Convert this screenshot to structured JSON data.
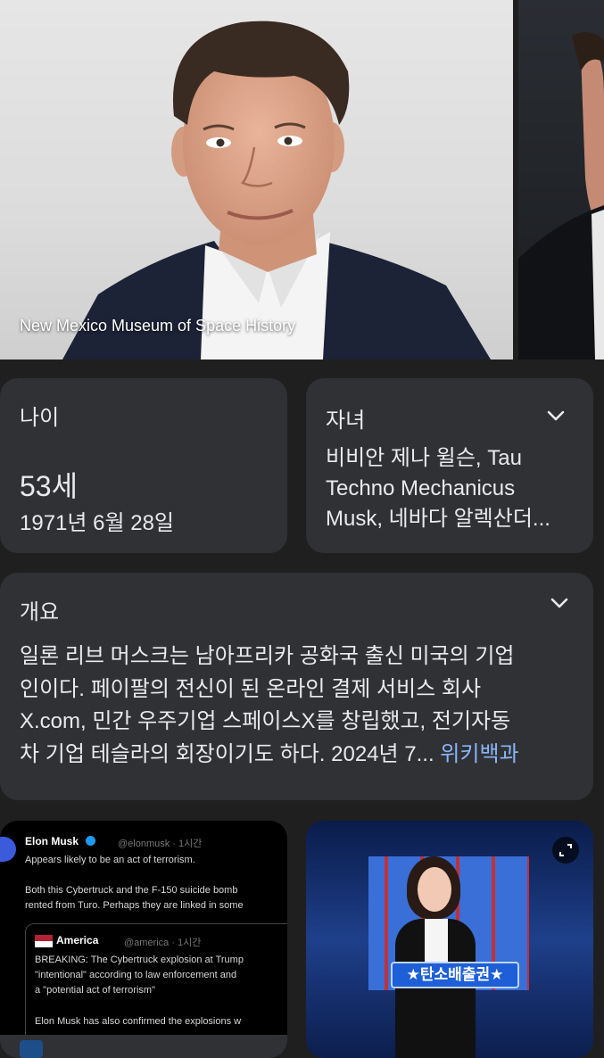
{
  "image_caption": "New Mexico Museum of Space History",
  "age_card": {
    "title": "나이",
    "value": "53세",
    "birthdate": "1971년 6월 28일"
  },
  "children_card": {
    "title": "자녀",
    "lines": [
      "비비안 제나 윌슨, Tau",
      "Techno Mechanicus",
      "Musk, 네바다 알렉산더..."
    ]
  },
  "overview_card": {
    "title": "개요",
    "lines": [
      "일론 리브 머스크는 남아프리카 공화국 출신 미국의 기업",
      "인이다. 페이팔의 전신이 된 온라인 결제 서비스 회사",
      "X.com, 민간 우주기업 스페이스X를 창립했고, 전기자동",
      "차 기업 테슬라의 회장이기도 하다. 2024년 7..."
    ],
    "source_link": "위키백과"
  },
  "tweet_thumb": {
    "name": "Elon Musk",
    "handle": "@elonmusk · 1시간",
    "line1": "Appears likely to be an act of terrorism.",
    "line2": "Both this Cybertruck and the F-150 suicide bomb",
    "line3": "rented from Turo. Perhaps they are linked in some",
    "quote_name": "America",
    "quote_handle": "@america · 1시간",
    "quote1": "BREAKING: The Cybertruck explosion at Trump",
    "quote2": "\"intentional\" according to law enforcement and",
    "quote3": "a \"potential act of terrorism\"",
    "quote4": "Elon Musk has also confirmed the explosions w"
  },
  "video_thumb": {
    "banner": "★탄소배출권★"
  },
  "colors": {
    "background": "#1f1f1f",
    "card": "#303134",
    "text": "#e8eaed",
    "link": "#8ab4f8"
  }
}
